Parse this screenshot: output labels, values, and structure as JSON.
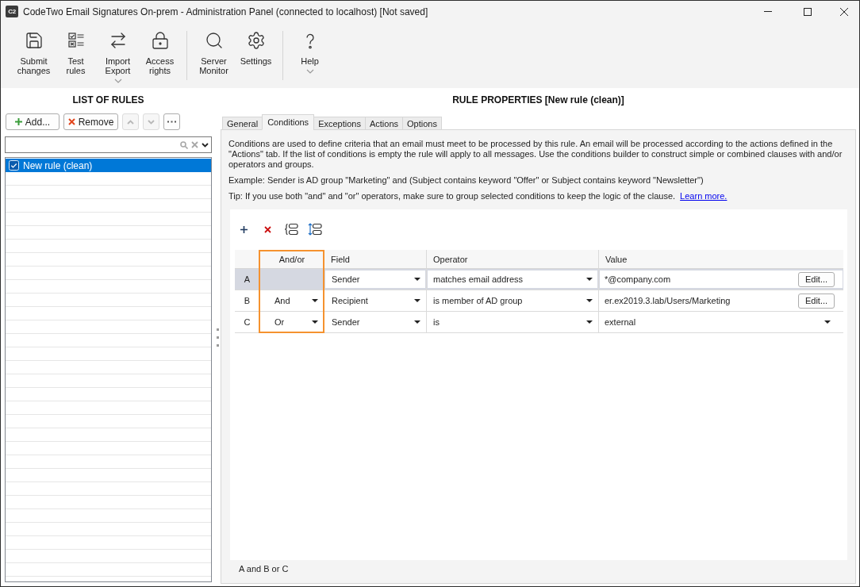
{
  "window": {
    "logo": "C2",
    "title": "CodeTwo Email Signatures On-prem - Administration Panel (connected to localhost) [Not saved]"
  },
  "toolbar": {
    "groups": [
      {
        "items": [
          {
            "label": "Submit changes",
            "has_menu": false
          },
          {
            "label": "Test rules",
            "has_menu": false
          },
          {
            "label": "Import Export",
            "has_menu": true
          },
          {
            "label": "Access rights",
            "has_menu": false
          }
        ]
      },
      {
        "items": [
          {
            "label": "Server Monitor",
            "has_menu": false
          },
          {
            "label": "Settings",
            "has_menu": false
          }
        ]
      },
      {
        "items": [
          {
            "label": "Help",
            "has_menu": true
          }
        ]
      }
    ]
  },
  "rules_panel": {
    "heading": "LIST OF RULES",
    "buttons": [
      {
        "kind": "add",
        "label": "Add...",
        "disabled": false
      },
      {
        "kind": "remove",
        "label": "Remove",
        "disabled": false
      },
      {
        "kind": "up",
        "disabled": true
      },
      {
        "kind": "down",
        "disabled": true
      },
      {
        "kind": "more",
        "disabled": false
      }
    ],
    "rules": [
      {
        "name": "New rule (clean)",
        "checked": true,
        "selected": true
      }
    ]
  },
  "properties": {
    "heading": "RULE PROPERTIES [New rule (clean)]",
    "tabs": [
      {
        "label": "General",
        "selected": false
      },
      {
        "label": "Conditions",
        "selected": true
      },
      {
        "label": "Exceptions",
        "selected": false
      },
      {
        "label": "Actions",
        "selected": false
      },
      {
        "label": "Options",
        "selected": false
      }
    ],
    "description": "Conditions are used to define criteria that an email must meet to be processed by this rule. An email will be processed according to the actions defined in the \"Actions\" tab. If the list of conditions is empty the rule will apply to all messages. Use the conditions builder to construct simple or combined clauses with and/or operators and groups.",
    "example": "Example: Sender is AD group \"Marketing\" and (Subject contains keyword \"Offer\" or Subject contains keyword \"Newsletter\")",
    "tip": "Tip: If you use both \"and\" and \"or\" operators, make sure to group selected conditions to keep the logic of the clause.",
    "tip_link": "Learn more.",
    "grid": {
      "columns": [
        {
          "label": "And/or",
          "highlighted": true
        },
        {
          "label": "Field",
          "highlighted": false
        },
        {
          "label": "Operator",
          "highlighted": false
        },
        {
          "label": "Value",
          "highlighted": false
        }
      ],
      "rows": [
        {
          "id": "A",
          "selected": true,
          "field": "Sender",
          "operator": "matches email address",
          "value": {
            "kind": "edit",
            "text": "*@company.com",
            "button": "Edit..."
          }
        },
        {
          "id": "B",
          "selected": false,
          "and_or": "And",
          "field": "Recipient",
          "operator": "is member of AD group",
          "value": {
            "kind": "edit",
            "text": "er.ex2019.3.lab/Users/Marketing",
            "button": "Edit..."
          }
        },
        {
          "id": "C",
          "selected": false,
          "and_or": "Or",
          "field": "Sender",
          "operator": "is",
          "value": {
            "kind": "dropdown",
            "text": "external"
          }
        }
      ]
    },
    "clause": "A and B or C"
  }
}
